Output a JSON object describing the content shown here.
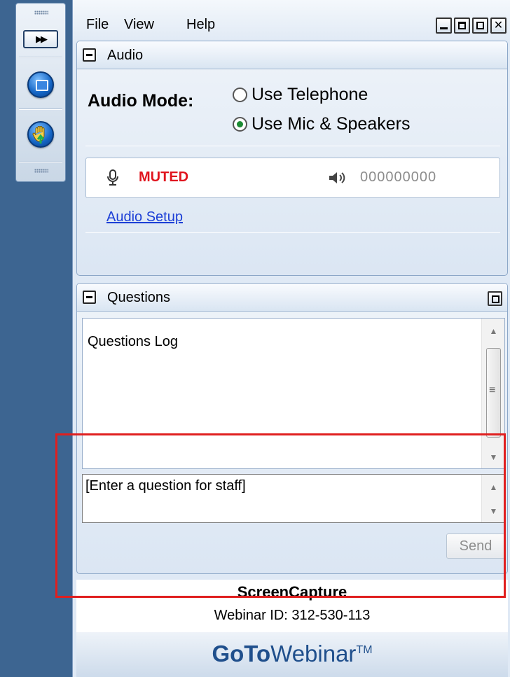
{
  "menubar": {
    "file": "File",
    "view": "View",
    "help": "Help",
    "close_glyph": "✕"
  },
  "toolbar": {
    "expand_glyph": "▶▶",
    "icons": [
      "grip-icon",
      "expand-icon",
      "show-screen-icon",
      "raise-hand-icon",
      "grip-icon"
    ]
  },
  "audio": {
    "title": "Audio",
    "mode_label": "Audio Mode:",
    "options": [
      {
        "label": "Use Telephone",
        "selected": false
      },
      {
        "label": "Use Mic & Speakers",
        "selected": true
      }
    ],
    "status": "MUTED",
    "level": "000000000",
    "setup_link": "Audio Setup"
  },
  "questions": {
    "title": "Questions",
    "log_title": "Questions Log",
    "input_value": "[Enter a question for staff]",
    "send_label": "Send"
  },
  "footer": {
    "session_name": "ScreenCapture",
    "webinar_id": "Webinar ID: 312-530-113"
  },
  "brand": {
    "goto": "GoTo",
    "webinar": "Webinar",
    "tm": "TM"
  },
  "colors": {
    "rail": "#3d6591",
    "muted": "#e0141e",
    "link": "#1c3fd6",
    "highlight": "#e01f1f",
    "brand": "#1f4f8c"
  }
}
